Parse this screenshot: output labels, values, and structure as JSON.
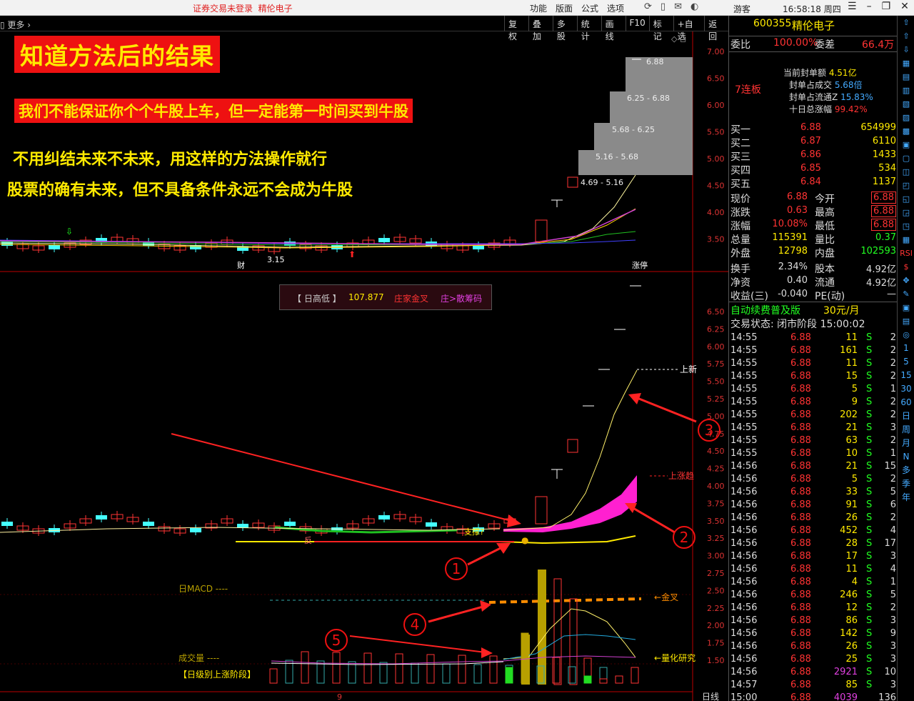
{
  "titlebar": {
    "status": "证券交易未登录",
    "stock_name": "精伦电子",
    "menu": [
      "功能",
      "版面",
      "公式",
      "选项"
    ],
    "guest": "游客",
    "time": "16:58:18 周四"
  },
  "toolbar": {
    "more": "更多",
    "buttons": [
      "复权",
      "叠加",
      "多股",
      "统计",
      "画线",
      "F10",
      "标记",
      "+自选",
      "返回"
    ]
  },
  "overlay": {
    "banner_title": "知道方法后的结果",
    "banner_sub": "我们不能保证你个个牛股上车，但一定能第一时间买到牛股",
    "line3": "不用纠结未来不未来，用这样的方法操作就行",
    "line4": "股票的确有未来，但不具备条件永远不会成为牛股"
  },
  "top_chart": {
    "y_ticks": [
      "7.00",
      "6.50",
      "6.00",
      "5.50",
      "5.00",
      "4.50",
      "4.00",
      "3.50"
    ],
    "chip_labels": [
      "6.88",
      "6.25 - 6.88",
      "5.68 - 6.25",
      "5.16 - 5.68",
      "4.69 - 5.16"
    ],
    "low_label": "3.15",
    "cai_label": "财",
    "zhangting_label": "涨停"
  },
  "infobox": {
    "label": "【 日高低 】",
    "value": "107.877",
    "tag1": "庄家金叉",
    "tag2": "庄>散筹码"
  },
  "main_chart": {
    "y_ticks": [
      "6.50",
      "6.25",
      "6.00",
      "5.75",
      "5.50",
      "5.25",
      "5.00",
      "4.75",
      "4.50",
      "4.25",
      "4.00",
      "3.75",
      "3.50",
      "3.25",
      "3.00",
      "2.75",
      "2.50",
      "2.25",
      "2.00",
      "1.75",
      "1.50"
    ],
    "support_label": "支撑?",
    "fan_label": "反",
    "label_shang_xin": "上新",
    "label_shang_zhang": "上涨趋",
    "label_jin_cha": "金叉",
    "label_lianghua": "量化研究",
    "macd_label": "日MACD",
    "vol_label": "成交量",
    "stage_label": "【日级别上涨阶段】",
    "date_mark": "9",
    "period": "日线",
    "circles": [
      "1",
      "2",
      "3",
      "4",
      "5"
    ]
  },
  "quote": {
    "code": "600355",
    "name": "精伦电子",
    "weibi_label": "委比",
    "weibi": "100.00%",
    "weicha_label": "委差",
    "weicha": "66.4万",
    "lianban": "7连板",
    "fengdan": [
      {
        "label": "当前封单额",
        "value": "4.51亿"
      },
      {
        "label": "封单占成交",
        "value": "5.68倍"
      },
      {
        "label": "封单占流通Z",
        "value": "15.83%"
      },
      {
        "label": "十日总涨幅",
        "value": "99.42%"
      }
    ],
    "bids": [
      {
        "label": "买一",
        "price": "6.88",
        "vol": "654999"
      },
      {
        "label": "买二",
        "price": "6.87",
        "vol": "6110"
      },
      {
        "label": "买三",
        "price": "6.86",
        "vol": "1433"
      },
      {
        "label": "买四",
        "price": "6.85",
        "vol": "534"
      },
      {
        "label": "买五",
        "price": "6.84",
        "vol": "1137"
      }
    ],
    "stats": [
      {
        "l1": "现价",
        "v1": "6.88",
        "l2": "今开",
        "v2": "6.88"
      },
      {
        "l1": "涨跌",
        "v1": "0.63",
        "l2": "最高",
        "v2": "6.88"
      },
      {
        "l1": "涨幅",
        "v1": "10.08%",
        "l2": "最低",
        "v2": "6.88"
      },
      {
        "l1": "总量",
        "v1": "115391",
        "l2": "量比",
        "v2": "0.37"
      },
      {
        "l1": "外盘",
        "v1": "12798",
        "l2": "内盘",
        "v2": "102593"
      }
    ],
    "stats2": [
      {
        "l1": "换手",
        "v1": "2.34%",
        "l2": "股本",
        "v2": "4.92亿"
      },
      {
        "l1": "净资",
        "v1": "0.40",
        "l2": "流通",
        "v2": "4.92亿"
      },
      {
        "l1": "收益(三)",
        "v1": "-0.040",
        "l2": "PE(动)",
        "v2": "—"
      }
    ],
    "promo": "自动续费普及版",
    "promo_price": "30元/月",
    "trade_state": "交易状态: 闭市阶段 15:00:02"
  },
  "ticks": [
    {
      "t": "14:55",
      "p": "6.88",
      "v": "11",
      "s": "S",
      "n": "2"
    },
    {
      "t": "14:55",
      "p": "6.88",
      "v": "161",
      "s": "S",
      "n": "2"
    },
    {
      "t": "14:55",
      "p": "6.88",
      "v": "11",
      "s": "S",
      "n": "2"
    },
    {
      "t": "14:55",
      "p": "6.88",
      "v": "15",
      "s": "S",
      "n": "2"
    },
    {
      "t": "14:55",
      "p": "6.88",
      "v": "5",
      "s": "S",
      "n": "1"
    },
    {
      "t": "14:55",
      "p": "6.88",
      "v": "9",
      "s": "S",
      "n": "2"
    },
    {
      "t": "14:55",
      "p": "6.88",
      "v": "202",
      "s": "S",
      "n": "2"
    },
    {
      "t": "14:55",
      "p": "6.88",
      "v": "21",
      "s": "S",
      "n": "3"
    },
    {
      "t": "14:55",
      "p": "6.88",
      "v": "63",
      "s": "S",
      "n": "2"
    },
    {
      "t": "14:55",
      "p": "6.88",
      "v": "10",
      "s": "S",
      "n": "1"
    },
    {
      "t": "14:56",
      "p": "6.88",
      "v": "21",
      "s": "S",
      "n": "15"
    },
    {
      "t": "14:56",
      "p": "6.88",
      "v": "5",
      "s": "S",
      "n": "2"
    },
    {
      "t": "14:56",
      "p": "6.88",
      "v": "33",
      "s": "S",
      "n": "5"
    },
    {
      "t": "14:56",
      "p": "6.88",
      "v": "91",
      "s": "S",
      "n": "6"
    },
    {
      "t": "14:56",
      "p": "6.88",
      "v": "26",
      "s": "S",
      "n": "2"
    },
    {
      "t": "14:56",
      "p": "6.88",
      "v": "452",
      "s": "S",
      "n": "4"
    },
    {
      "t": "14:56",
      "p": "6.88",
      "v": "28",
      "s": "S",
      "n": "17"
    },
    {
      "t": "14:56",
      "p": "6.88",
      "v": "17",
      "s": "S",
      "n": "3"
    },
    {
      "t": "14:56",
      "p": "6.88",
      "v": "11",
      "s": "S",
      "n": "4"
    },
    {
      "t": "14:56",
      "p": "6.88",
      "v": "4",
      "s": "S",
      "n": "1"
    },
    {
      "t": "14:56",
      "p": "6.88",
      "v": "246",
      "s": "S",
      "n": "5"
    },
    {
      "t": "14:56",
      "p": "6.88",
      "v": "12",
      "s": "S",
      "n": "2"
    },
    {
      "t": "14:56",
      "p": "6.88",
      "v": "86",
      "s": "S",
      "n": "3"
    },
    {
      "t": "14:56",
      "p": "6.88",
      "v": "142",
      "s": "S",
      "n": "9"
    },
    {
      "t": "14:56",
      "p": "6.88",
      "v": "26",
      "s": "S",
      "n": "3"
    },
    {
      "t": "14:56",
      "p": "6.88",
      "v": "25",
      "s": "S",
      "n": "3"
    },
    {
      "t": "14:56",
      "p": "6.88",
      "v": "2921",
      "s": "S",
      "n": "10"
    },
    {
      "t": "14:57",
      "p": "6.88",
      "v": "85",
      "s": "S",
      "n": "3"
    },
    {
      "t": "15:00",
      "p": "6.88",
      "v": "4039",
      "s": "",
      "n": "136"
    }
  ],
  "sidebar": [
    "1",
    "5",
    "15",
    "30",
    "60",
    "日",
    "周",
    "月",
    "N",
    "多",
    "季",
    "年"
  ]
}
